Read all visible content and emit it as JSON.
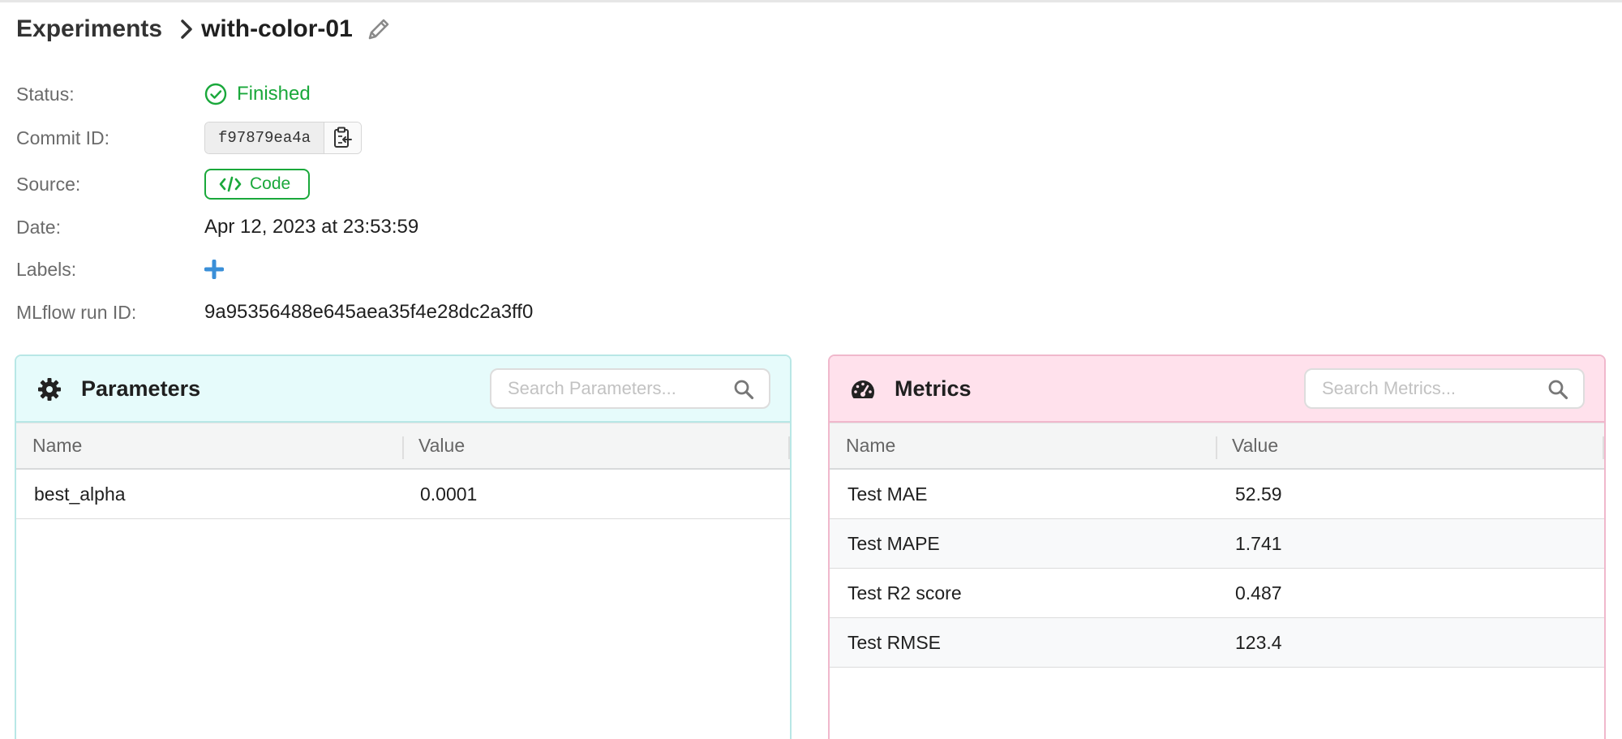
{
  "breadcrumb": {
    "parent": "Experiments",
    "current": "with-color-01"
  },
  "meta": {
    "status_label": "Status:",
    "status_value": "Finished",
    "commit_label": "Commit ID:",
    "commit_value": "f97879ea4a",
    "source_label": "Source:",
    "source_button": "Code",
    "date_label": "Date:",
    "date_value": "Apr 12, 2023 at 23:53:59",
    "labels_label": "Labels:",
    "runid_label": "MLflow run ID:",
    "runid_value": "9a95356488e645aea35f4e28dc2a3ff0"
  },
  "parameters": {
    "title": "Parameters",
    "search_placeholder": "Search Parameters...",
    "columns": [
      "Name",
      "Value"
    ],
    "rows": [
      {
        "name": "best_alpha",
        "value": "0.0001"
      }
    ]
  },
  "metrics": {
    "title": "Metrics",
    "search_placeholder": "Search Metrics...",
    "columns": [
      "Name",
      "Value"
    ],
    "rows": [
      {
        "name": "Test MAE",
        "value": "52.59"
      },
      {
        "name": "Test MAPE",
        "value": "1.741"
      },
      {
        "name": "Test R2 score",
        "value": "0.487"
      },
      {
        "name": "Test RMSE",
        "value": "123.4"
      }
    ]
  },
  "icons": {
    "chevron": "chevron-right-icon",
    "edit": "pencil-icon",
    "status": "check-circle-icon",
    "copy": "clipboard-icon",
    "code": "code-icon",
    "add": "plus-icon",
    "params": "gear-icon",
    "metrics": "dashboard-gauge-icon",
    "search": "search-icon"
  },
  "colors": {
    "success": "#1aa83b",
    "add": "#3a8fd8",
    "params_header": "#e6fbfb",
    "metrics_header": "#ffe1ec"
  }
}
